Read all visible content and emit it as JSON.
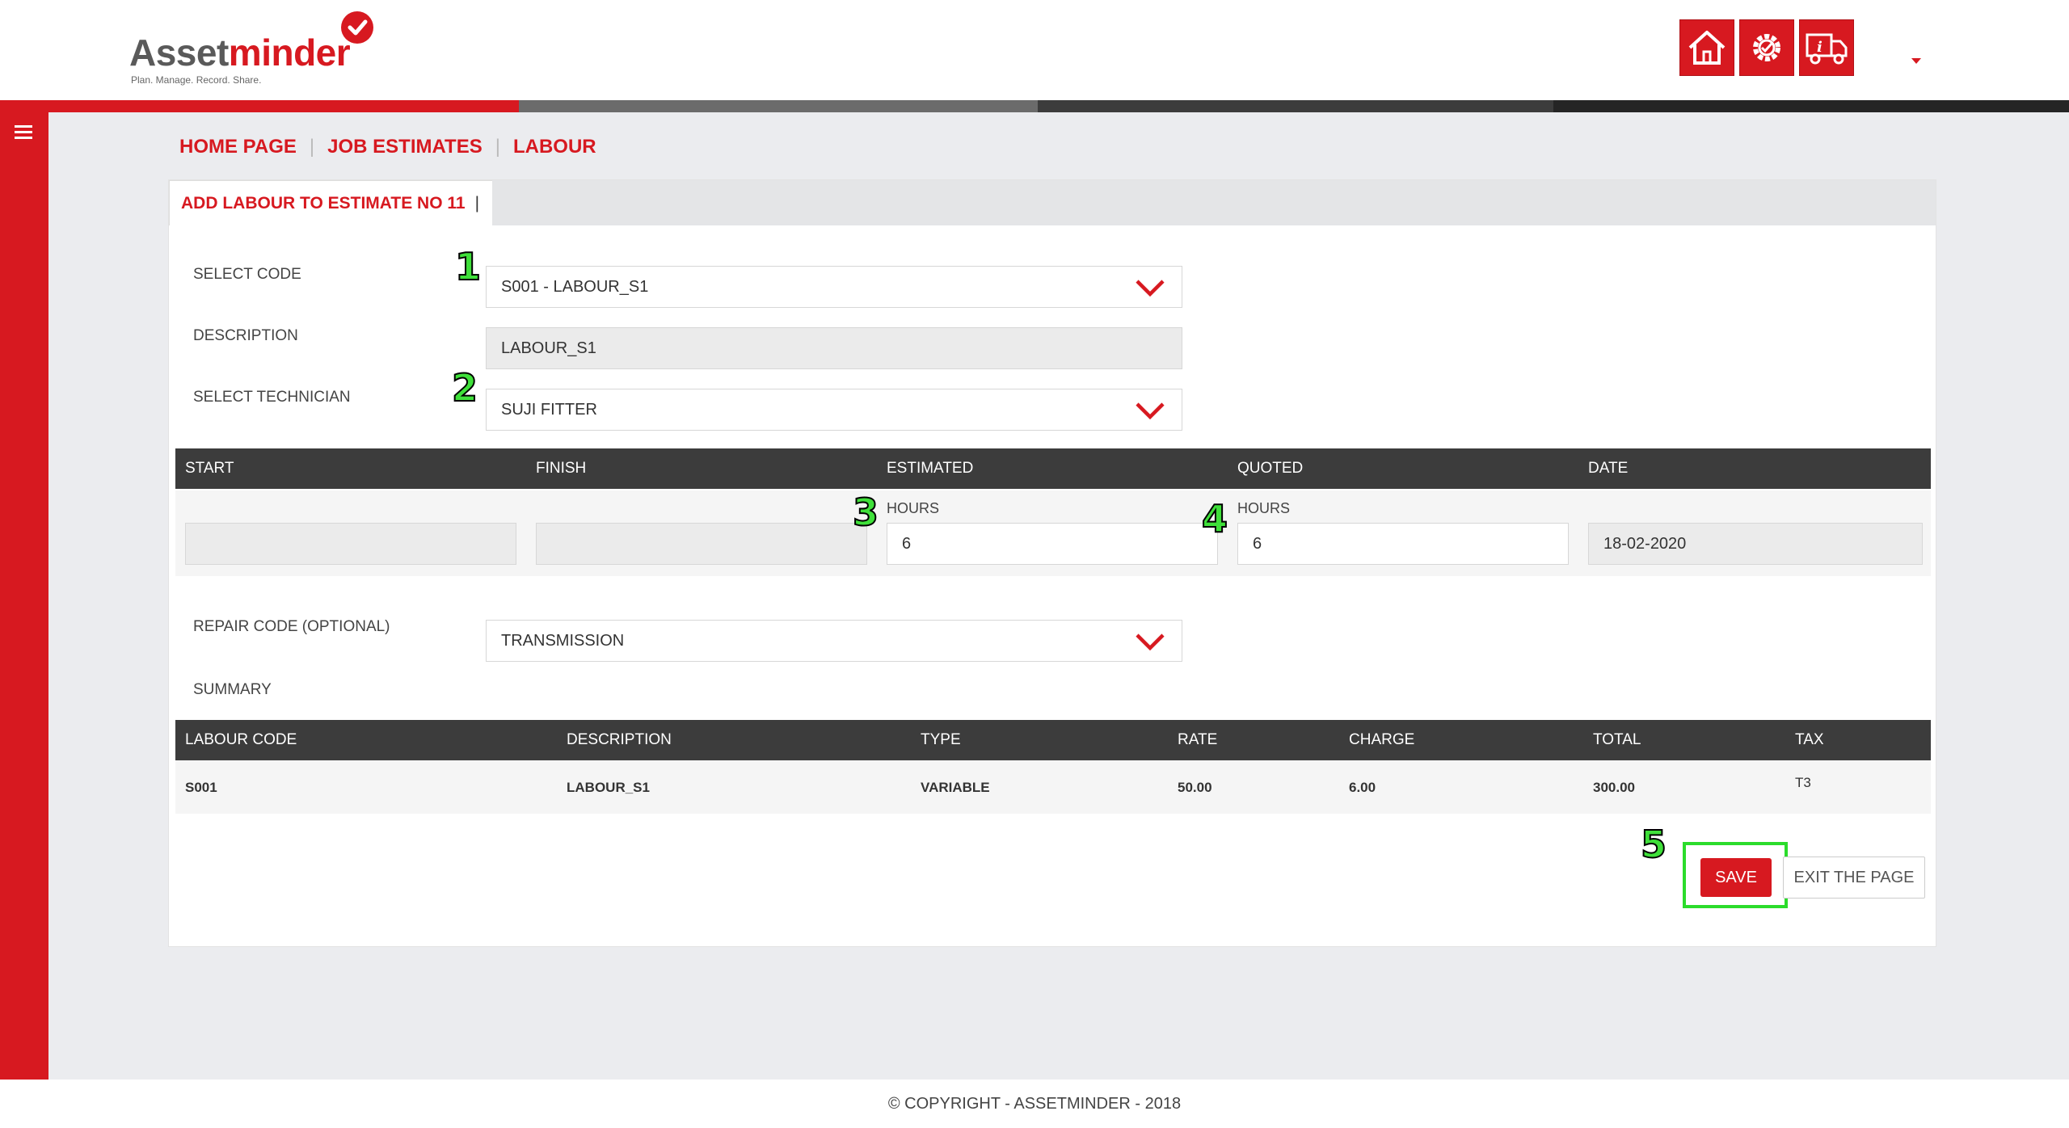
{
  "brand": {
    "name_part1": "Asset",
    "name_part2": "minder",
    "tagline": "Plan. Manage. Record. Share.",
    "logo_icon": "checkmark-badge-icon"
  },
  "header": {
    "buttons": [
      {
        "name": "home",
        "icon": "home-icon"
      },
      {
        "name": "settings",
        "icon": "gear-icon"
      },
      {
        "name": "vehicle-info",
        "icon": "truck-info-icon"
      }
    ],
    "user_menu_icon": "caret-down-icon"
  },
  "colors": {
    "accent": "#d71920",
    "dark": "#3c3c3c",
    "annotation": "#3fe03a"
  },
  "sidebar": {
    "menu_icon": "hamburger-icon"
  },
  "breadcrumb": {
    "items": [
      "HOME PAGE",
      "JOB ESTIMATES",
      "LABOUR"
    ],
    "separator": "|"
  },
  "tab": {
    "title": "ADD LABOUR TO ESTIMATE NO 11",
    "bar": "|"
  },
  "form": {
    "select_code_label": "SELECT CODE",
    "select_code_value": "S001 - LABOUR_S1",
    "description_label": "DESCRIPTION",
    "description_value": "LABOUR_S1",
    "technician_label": "SELECT TECHNICIAN",
    "technician_value": "SUJI FITTER",
    "repair_code_label": "REPAIR CODE (OPTIONAL)",
    "repair_code_value": "TRANSMISSION",
    "summary_label": "SUMMARY"
  },
  "time_table": {
    "headers": [
      "START",
      "FINISH",
      "ESTIMATED",
      "QUOTED",
      "DATE"
    ],
    "estimated_sub": "HOURS",
    "quoted_sub": "HOURS",
    "start_value": "",
    "finish_value": "",
    "estimated_value": "6",
    "quoted_value": "6",
    "date_value": "18-02-2020"
  },
  "summary_table": {
    "headers": [
      "LABOUR CODE",
      "DESCRIPTION",
      "TYPE",
      "RATE",
      "CHARGE",
      "TOTAL",
      "TAX"
    ],
    "row": [
      "S001",
      "LABOUR_S1",
      "VARIABLE",
      "50.00",
      "6.00",
      "300.00",
      "T3"
    ]
  },
  "annotations": [
    "1",
    "2",
    "3",
    "4",
    "5"
  ],
  "actions": {
    "save": "SAVE",
    "exit": "EXIT THE PAGE"
  },
  "footer": {
    "text": "© COPYRIGHT - ASSETMINDER - 2018"
  }
}
